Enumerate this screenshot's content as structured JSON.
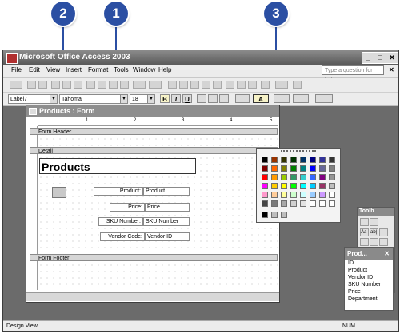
{
  "callouts": [
    "2",
    "1",
    "3"
  ],
  "window": {
    "title": "Microsoft Office Access 2003",
    "min_label": "_",
    "max_label": "□",
    "close_label": "✕"
  },
  "menubar": {
    "items": [
      "File",
      "Edit",
      "View",
      "Insert",
      "Format",
      "Tools",
      "Window",
      "Help"
    ],
    "help_placeholder": "Type a question for help",
    "doc_close_label": "✕"
  },
  "format_toolbar": {
    "object_combo": "Label7",
    "font_combo": "Tahoma",
    "size_combo": "18",
    "bold": "B",
    "italic": "I",
    "underline": "U",
    "font_color": "A"
  },
  "form": {
    "title": "Products : Form",
    "ruler_marks": [
      "1",
      "2",
      "3",
      "4",
      "5"
    ],
    "sections": {
      "header": "Form Header",
      "detail": "Detail",
      "footer": "Form Footer"
    },
    "heading": "Products",
    "fields": [
      {
        "label": "Product:",
        "value": "Product"
      },
      {
        "label": "Price:",
        "value": "Price"
      },
      {
        "label": "SKU Number:",
        "value": "SKU Number"
      },
      {
        "label": "Vendor Code:",
        "value": "Vendor ID"
      }
    ]
  },
  "palette_colors": [
    "#000000",
    "#993300",
    "#333300",
    "#003300",
    "#003366",
    "#000080",
    "#333399",
    "#333333",
    "#800000",
    "#ff6600",
    "#808000",
    "#008000",
    "#008080",
    "#0000ff",
    "#666699",
    "#808080",
    "#ff0000",
    "#ff9900",
    "#99cc00",
    "#339966",
    "#33cccc",
    "#3366ff",
    "#800080",
    "#969696",
    "#ff00ff",
    "#ffcc00",
    "#ffff00",
    "#00ff00",
    "#00ffff",
    "#00ccff",
    "#993366",
    "#c0c0c0",
    "#ff99cc",
    "#ffcc99",
    "#ffff99",
    "#ccffcc",
    "#ccffff",
    "#99ccff",
    "#cc99ff",
    "#ffffff"
  ],
  "palette_grays": [
    "#444444",
    "#7a7a7a",
    "#a8a8a8",
    "#d0d0d0",
    "#e2e2e2",
    "#ffffff",
    "#ffffff",
    "#ffffff"
  ],
  "palette_custom": [
    "#000000",
    "#bdbdbd",
    "#bdbdbd"
  ],
  "toolbox": {
    "title": "Toolb",
    "tools": [
      "Aa",
      "ab|"
    ]
  },
  "field_list": {
    "title": "Prod...",
    "items": [
      "ID",
      "Product",
      "Vendor ID",
      "SKU Number",
      "Price",
      "Department"
    ]
  },
  "status": {
    "left": "Design View",
    "right": "NUM"
  }
}
